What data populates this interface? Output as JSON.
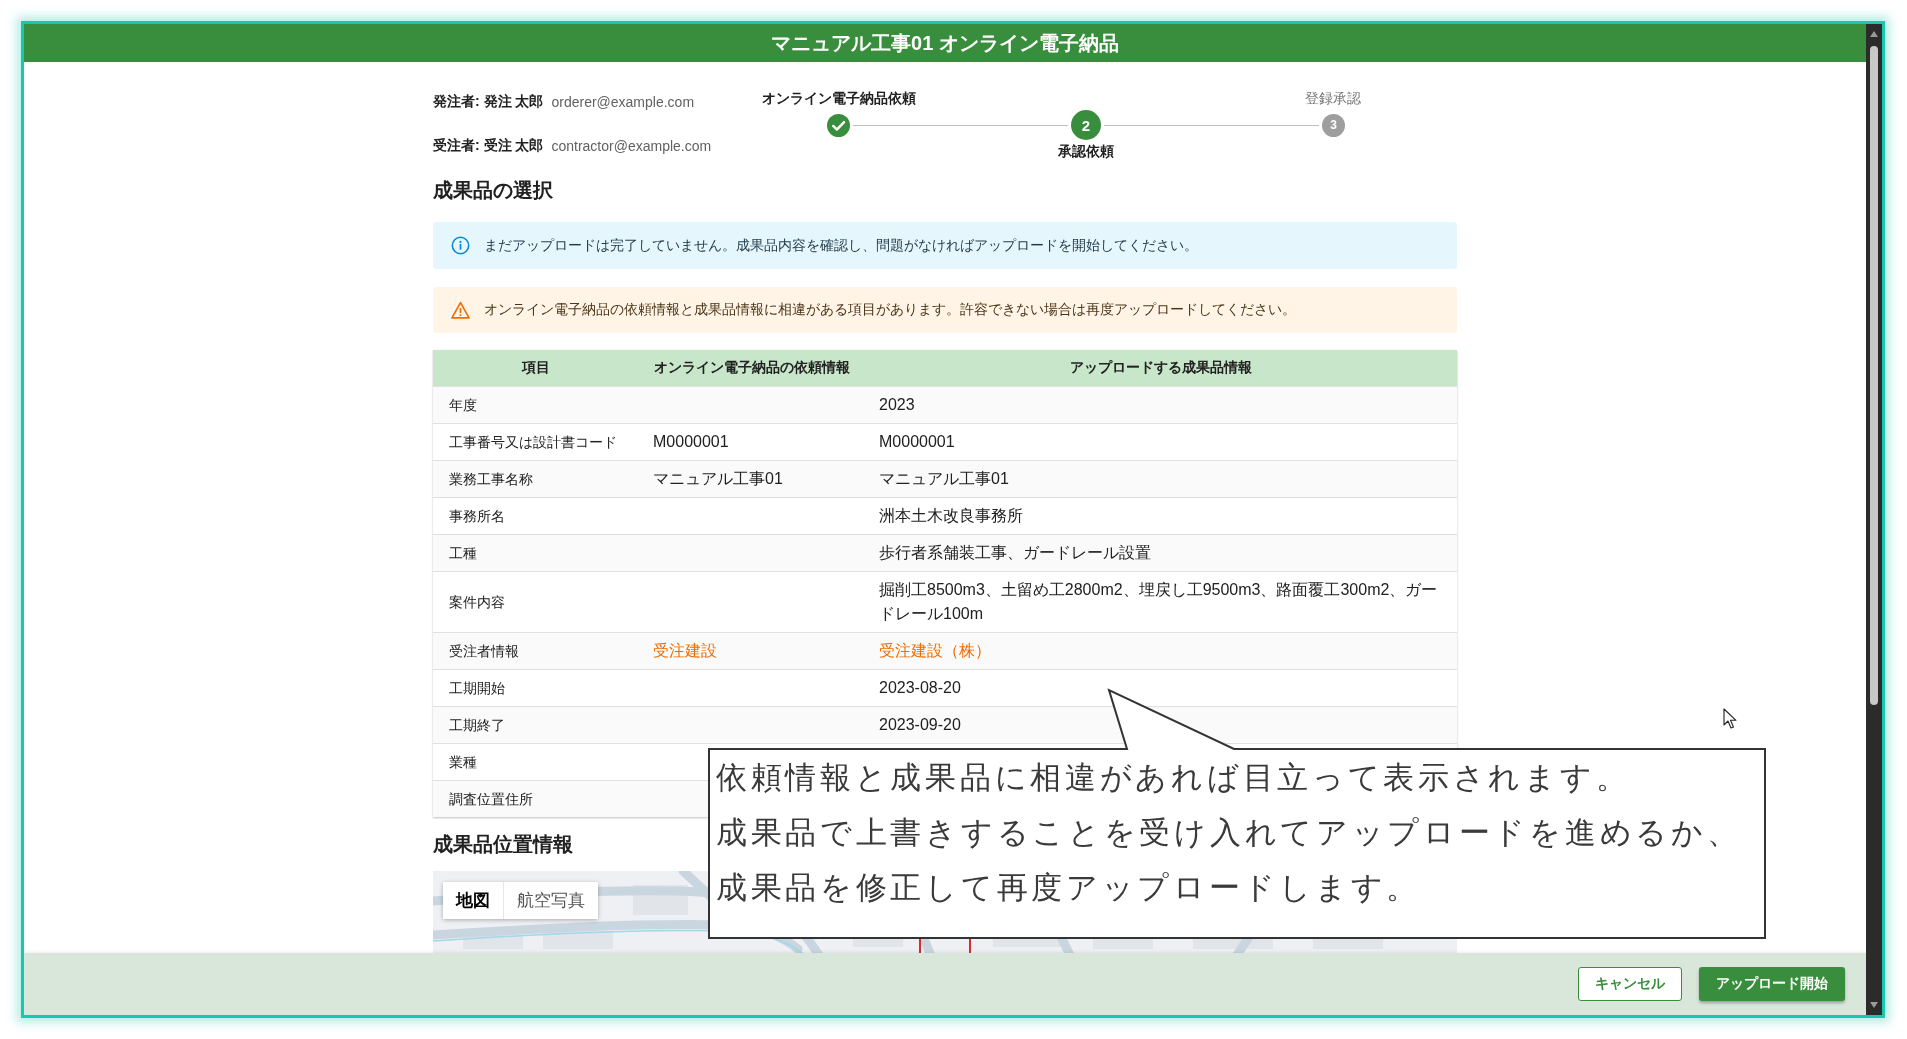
{
  "window": {
    "title": "マニュアル工事01 オンライン電子納品"
  },
  "parties": [
    {
      "label": "発注者: 発注 太郎",
      "email": "orderer@example.com"
    },
    {
      "label": "受注者: 受注 太郎",
      "email": "contractor@example.com"
    }
  ],
  "stepper": [
    {
      "label": "オンライン電子納品依頼",
      "completed": true,
      "selected": false
    },
    {
      "label": "承認依頼",
      "number": "2",
      "completed": false,
      "selected": true
    },
    {
      "label": "登録承認",
      "number": "3",
      "completed": false,
      "selected": false
    }
  ],
  "selection": {
    "heading": "成果品の選択",
    "alerts": [
      {
        "kind": "info",
        "text": "まだアップロードは完了していません。成果品内容を確認し、問題がなければアップロードを開始してください。"
      },
      {
        "kind": "warning",
        "text": "オンライン電子納品の依頼情報と成果品情報に相違がある項目があります。許容できない場合は再度アップロードしてください。"
      }
    ],
    "table": {
      "columns": [
        "項目",
        "オンライン電子納品の依頼情報",
        "アップロードする成果品情報"
      ],
      "rows": [
        {
          "label": "年度",
          "upload": "2023",
          "mismatch": false
        },
        {
          "label": "工事番号又は設計書コード",
          "request": "M0000001",
          "upload": "M0000001",
          "mismatch": false
        },
        {
          "label": "業務工事名称",
          "request": "マニュアル工事01",
          "upload": "マニュアル工事01",
          "mismatch": false
        },
        {
          "label": "事務所名",
          "upload": "洲本土木改良事務所",
          "mismatch": false
        },
        {
          "label": "工種",
          "upload": "歩行者系舗装工事、ガードレール設置",
          "mismatch": false
        },
        {
          "label": "案件内容",
          "upload": "掘削工8500m3、土留め工2800m2、埋戻し工9500m3、路面覆工300m2、ガードレール100m",
          "mismatch": false
        },
        {
          "label": "受注者情報",
          "request": "受注建設",
          "upload": "受注建設（株）",
          "mismatch": true
        },
        {
          "label": "工期開始",
          "upload": "2023-08-20",
          "mismatch": false
        },
        {
          "label": "工期終了",
          "upload": "2023-09-20",
          "mismatch": false
        },
        {
          "label": "業種"
        },
        {
          "label": "調査位置住所"
        }
      ]
    }
  },
  "callout": {
    "lines": [
      "依頼情報と成果品に相違があれば目立って表示されます。",
      "成果品で上書きすることを受け入れてアップロードを進めるか、",
      "成果品を修正して再度アップロードします。"
    ]
  },
  "location": {
    "heading": "成果品位置情報",
    "map_types": [
      {
        "label": "地図",
        "selected": true
      },
      {
        "label": "航空写真",
        "selected": false
      }
    ]
  },
  "actions": [
    {
      "label": "キャンセル",
      "kind": "outlined"
    },
    {
      "label": "アップロード開始",
      "kind": "contained"
    }
  ]
}
